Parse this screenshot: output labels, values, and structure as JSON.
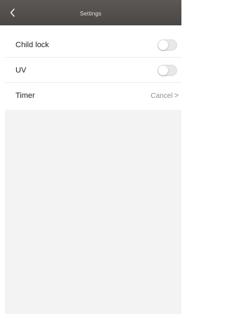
{
  "header": {
    "title": "Settings",
    "back_icon": "chevron-left-icon"
  },
  "settings": {
    "child_lock": {
      "label": "Child lock",
      "enabled": false
    },
    "uv": {
      "label": "UV",
      "enabled": false
    },
    "timer": {
      "label": "Timer",
      "value": "Cancel",
      "chevron": ">"
    }
  },
  "colors": {
    "nav_bar": "#4f4c49",
    "nav_title": "#e6e3df",
    "toggle_off": "#e8e8e8",
    "content_bg": "#f3f3f3"
  }
}
